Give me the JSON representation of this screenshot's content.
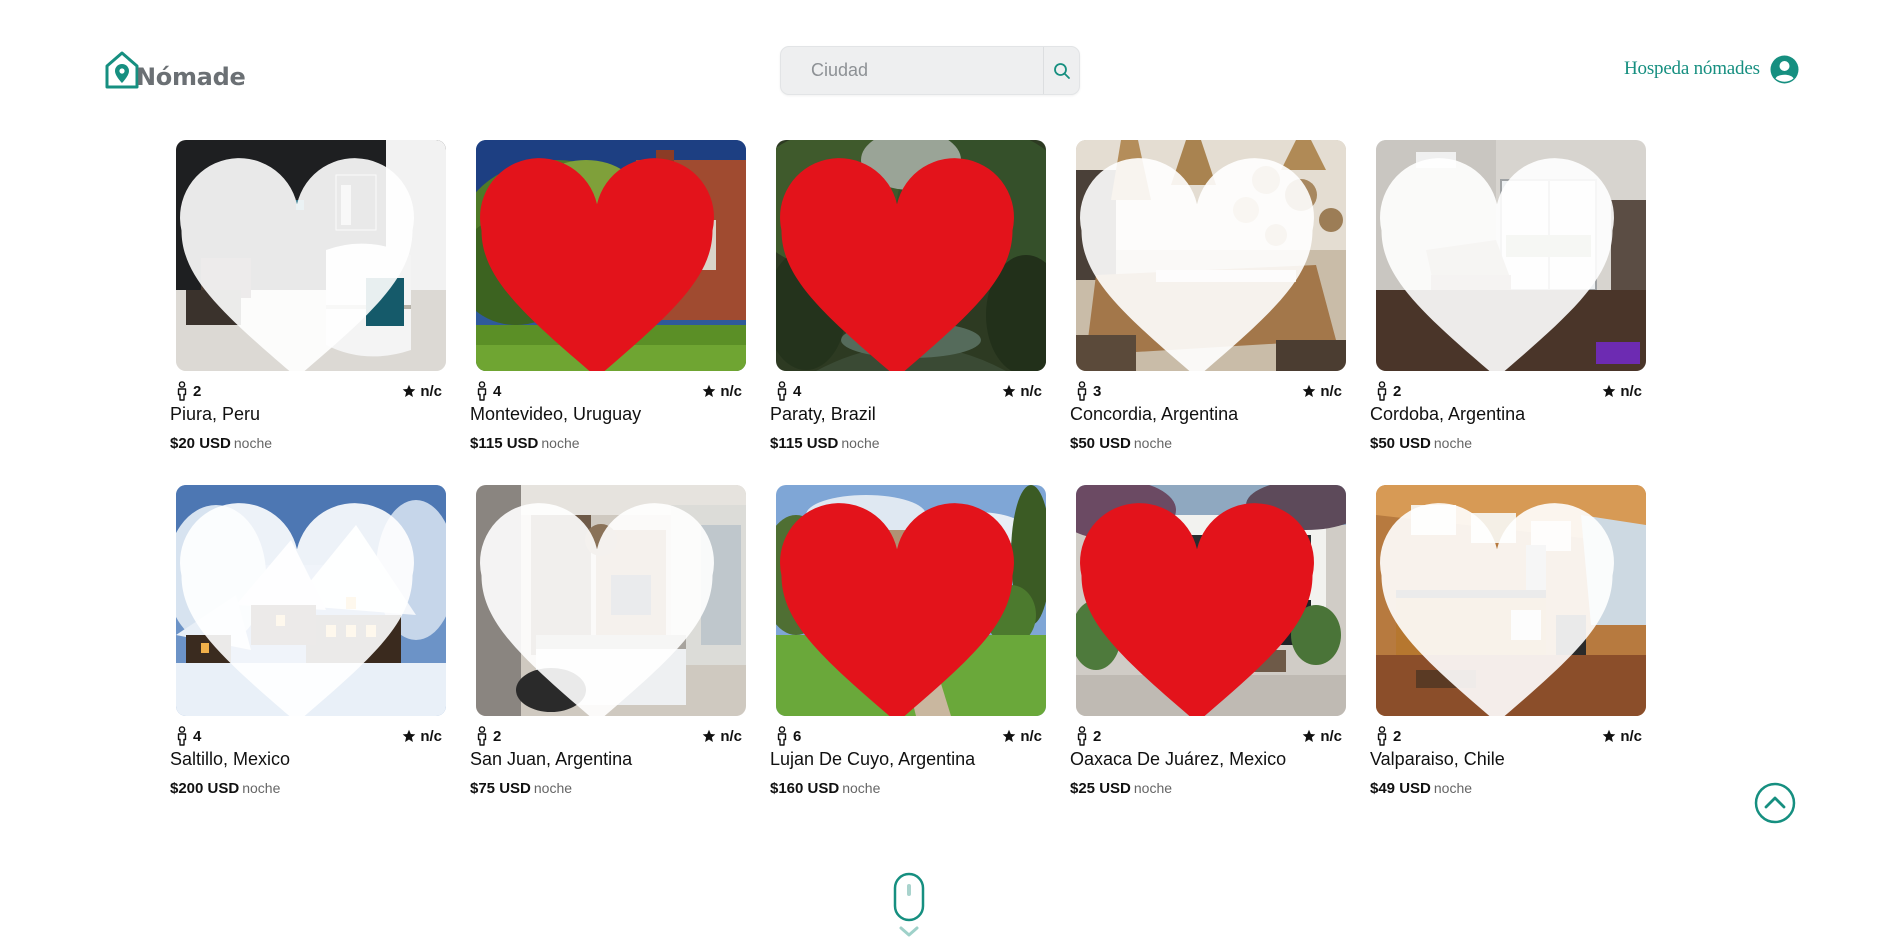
{
  "header": {
    "logo_text": "Nómade",
    "search_placeholder": "Ciudad",
    "host_link": "Hospeda nómades"
  },
  "listings": [
    {
      "guests": "2",
      "rating": "n/c",
      "city": "Piura, Peru",
      "price": "$20 USD",
      "unit": "noche",
      "favorite": false,
      "photo": "lobby"
    },
    {
      "guests": "4",
      "rating": "n/c",
      "city": "Montevideo, Uruguay",
      "price": "$115 USD",
      "unit": "noche",
      "favorite": true,
      "photo": "garden"
    },
    {
      "guests": "4",
      "rating": "n/c",
      "city": "Paraty, Brazil",
      "price": "$115 USD",
      "unit": "noche",
      "favorite": true,
      "photo": "jungle"
    },
    {
      "guests": "3",
      "rating": "n/c",
      "city": "Concordia, Argentina",
      "price": "$50 USD",
      "unit": "noche",
      "favorite": false,
      "photo": "dining"
    },
    {
      "guests": "2",
      "rating": "n/c",
      "city": "Cordoba, Argentina",
      "price": "$50 USD",
      "unit": "noche",
      "favorite": false,
      "photo": "apartment"
    },
    {
      "guests": "4",
      "rating": "n/c",
      "city": "Saltillo, Mexico",
      "price": "$200 USD",
      "unit": "noche",
      "favorite": false,
      "photo": "snow"
    },
    {
      "guests": "2",
      "rating": "n/c",
      "city": "San Juan, Argentina",
      "price": "$75 USD",
      "unit": "noche",
      "favorite": false,
      "photo": "bedroom"
    },
    {
      "guests": "6",
      "rating": "n/c",
      "city": "Lujan De Cuyo, Argentina",
      "price": "$160 USD",
      "unit": "noche",
      "favorite": true,
      "photo": "villa"
    },
    {
      "guests": "2",
      "rating": "n/c",
      "city": "Oaxaca De Juárez, Mexico",
      "price": "$25 USD",
      "unit": "noche",
      "favorite": true,
      "photo": "courtyard"
    },
    {
      "guests": "2",
      "rating": "n/c",
      "city": "Valparaiso, Chile",
      "price": "$49 USD",
      "unit": "noche",
      "favorite": false,
      "photo": "loft"
    }
  ],
  "colors": {
    "brand": "#168f80",
    "heart_favorite": "#e3131b",
    "heart_default": "#ffffff"
  },
  "icons": {
    "logo": "house-pin-icon",
    "search": "search-icon",
    "user": "user-circle-icon",
    "guests": "person-icon",
    "rating": "star-icon",
    "favorite": "heart-icon",
    "to_top": "chevron-up-circle-icon",
    "scroll": "mouse-scroll-icon"
  }
}
